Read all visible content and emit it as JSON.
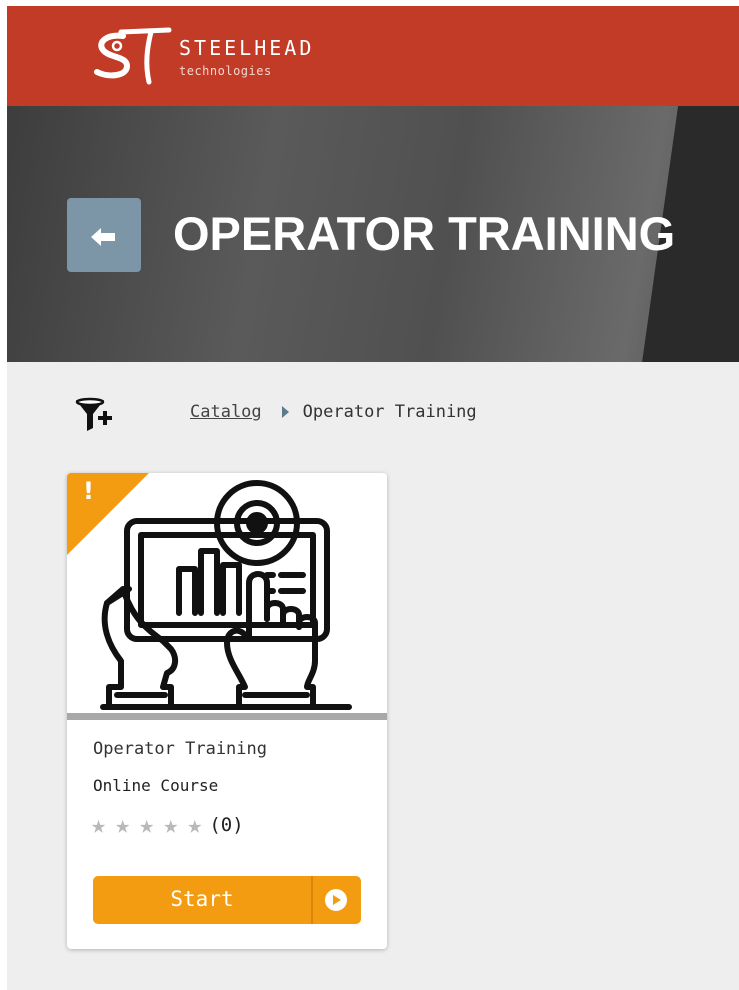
{
  "brand": {
    "name": "STEELHEAD",
    "tagline": "technologies",
    "logo_mark": "ST",
    "header_color": "#c23b26"
  },
  "hero": {
    "title": "OPERATOR TRAINING",
    "back_icon": "arrow-return-left-icon"
  },
  "filter": {
    "icon": "filter-add-icon"
  },
  "breadcrumb": {
    "items": [
      {
        "label": "Catalog",
        "link": true
      },
      {
        "label": "Operator Training",
        "link": false
      }
    ]
  },
  "card": {
    "badge": "!",
    "badge_color": "#f39c12",
    "thumbnail_icon": "hands-tablet-gear-icon",
    "title": "Operator Training",
    "type": "Online Course",
    "rating": {
      "stars": 0,
      "max": 5,
      "count": "(0)"
    },
    "action": {
      "label": "Start",
      "icon": "play-circle-icon",
      "color": "#f39c12"
    }
  }
}
